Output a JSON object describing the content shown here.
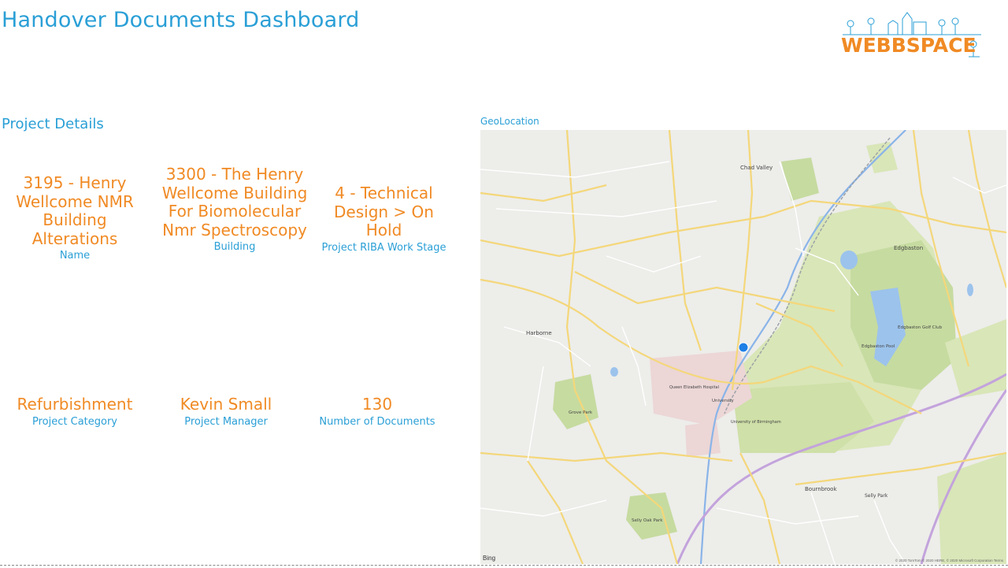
{
  "page": {
    "title": "Handover Documents Dashboard",
    "logo_text": "WEBBSPACE",
    "section_title": "Project Details",
    "map_title": "GeoLocation"
  },
  "cards": [
    {
      "value": "3195 - Henry Wellcome NMR Building Alterations",
      "label": "Name"
    },
    {
      "value": "3300 - The Henry Wellcome Building For Biomolecular Nmr Spectroscopy",
      "label": "Building"
    },
    {
      "value": "4 - Technical Design > On Hold",
      "label": "Project RIBA Work Stage"
    },
    {
      "value": "Refurbishment",
      "label": "Project Category"
    },
    {
      "value": "Kevin Small",
      "label": "Project Manager"
    },
    {
      "value": "130",
      "label": "Number of Documents"
    }
  ],
  "map": {
    "attribution": "Bing",
    "copyright": "© 2020 TomTom © 2020 HERE, © 2020 Microsoft Corporation Terms",
    "labels": {
      "chad_valley": "Chad Valley",
      "edgbaston": "Edgbaston",
      "harborne": "Harborne",
      "bournbrook": "Bournbrook",
      "selly_park": "Selly Park",
      "grove_park": "Grove Park",
      "selly_oak_park": "Selly Oak Park",
      "edgbaston_golf": "Edgbaston Golf Club",
      "edgbaston_pool": "Edgbaston Pool",
      "university": "University",
      "qehb": "Queen Elizabeth Hospital",
      "uob": "University of Birmingham"
    }
  },
  "colors": {
    "title": "#2a9fd6",
    "value": "#f08a24",
    "marker": "#1e7fe6"
  }
}
